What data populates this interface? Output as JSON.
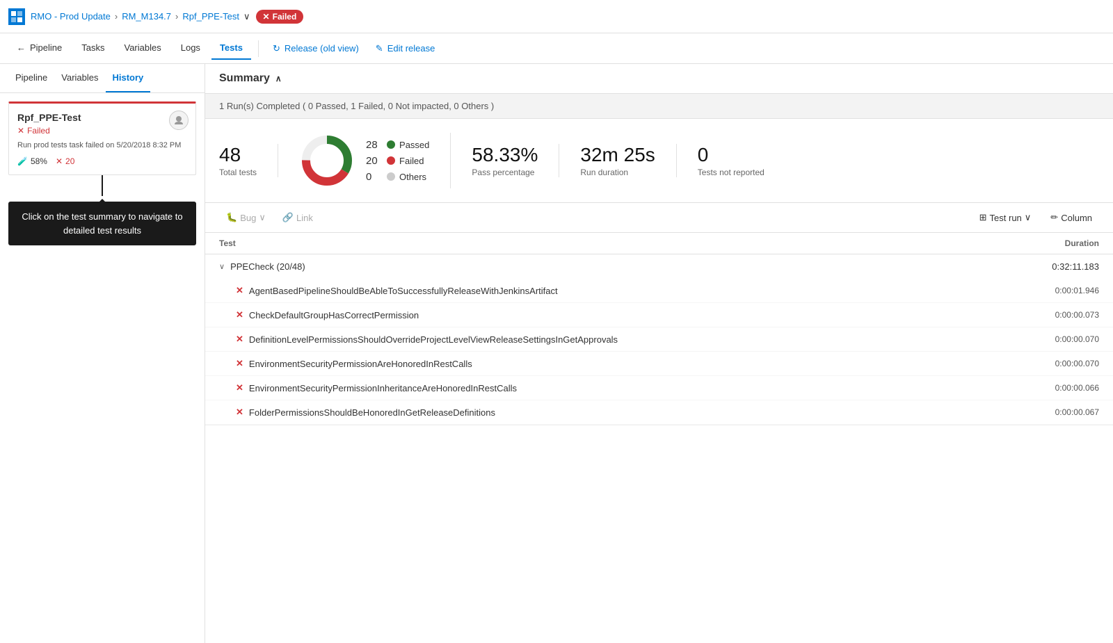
{
  "topHeader": {
    "logoText": "↑",
    "breadcrumb": [
      "RMO - Prod Update",
      "RM_M134.7",
      "Rpf_PPE-Test"
    ],
    "failedLabel": "Failed"
  },
  "navTabs": {
    "backLabel": "Pipeline",
    "tabs": [
      {
        "id": "tasks",
        "label": "Tasks"
      },
      {
        "id": "variables",
        "label": "Variables"
      },
      {
        "id": "logs",
        "label": "Logs"
      },
      {
        "id": "tests",
        "label": "Tests",
        "active": true
      }
    ],
    "releaseOldView": "Release (old view)",
    "editRelease": "Edit release"
  },
  "sidebar": {
    "tabs": [
      {
        "id": "pipeline",
        "label": "Pipeline"
      },
      {
        "id": "variables",
        "label": "Variables"
      },
      {
        "id": "history",
        "label": "History",
        "active": true
      }
    ],
    "stageCard": {
      "title": "Rpf_PPE-Test",
      "status": "Failed",
      "description": "Run prod tests task failed on 5/20/2018 8:32 PM",
      "passPct": "58%",
      "failCount": "20"
    },
    "tooltip": "Click on the test summary to navigate to detailed test results"
  },
  "summary": {
    "title": "Summary",
    "runsBar": "1 Run(s) Completed ( 0 Passed, 1 Failed, 0 Not impacted, 0 Others )",
    "totalTests": "48",
    "totalTestsLabel": "Total tests",
    "chart": {
      "passed": 28,
      "failed": 20,
      "others": 0,
      "total": 48
    },
    "legend": [
      {
        "label": "Passed",
        "value": "28",
        "color": "green"
      },
      {
        "label": "Failed",
        "value": "20",
        "color": "red"
      },
      {
        "label": "Others",
        "value": "0",
        "color": "gray"
      }
    ],
    "passPercentage": "58.33%",
    "passPercentageLabel": "Pass percentage",
    "runDuration": "32m 25s",
    "runDurationLabel": "Run duration",
    "testsNotReported": "0",
    "testsNotReportedLabel": "Tests not reported"
  },
  "toolbar": {
    "bugLabel": "Bug",
    "linkLabel": "Link",
    "testRunLabel": "Test run",
    "columnLabel": "Column"
  },
  "testTable": {
    "colTest": "Test",
    "colDuration": "Duration",
    "groups": [
      {
        "name": "PPECheck",
        "count": "20/48",
        "duration": "0:32:11.183",
        "tests": [
          {
            "name": "AgentBasedPipelineShouldBeAbleToSuccessfullyReleaseWithJenkinsArtifact",
            "duration": "0:00:01.946",
            "status": "failed"
          },
          {
            "name": "CheckDefaultGroupHasCorrectPermission",
            "duration": "0:00:00.073",
            "status": "failed"
          },
          {
            "name": "DefinitionLevelPermissionsShouldOverrideProjectLevelViewReleaseSettingsInGetApprovals",
            "duration": "0:00:00.070",
            "status": "failed"
          },
          {
            "name": "EnvironmentSecurityPermissionAreHonoredInRestCalls",
            "duration": "0:00:00.070",
            "status": "failed"
          },
          {
            "name": "EnvironmentSecurityPermissionInheritanceAreHonoredInRestCalls",
            "duration": "0:00:00.066",
            "status": "failed"
          },
          {
            "name": "FolderPermissionsShouldBeHonoredInGetReleaseDefinitions",
            "duration": "0:00:00.067",
            "status": "failed"
          }
        ]
      }
    ]
  }
}
